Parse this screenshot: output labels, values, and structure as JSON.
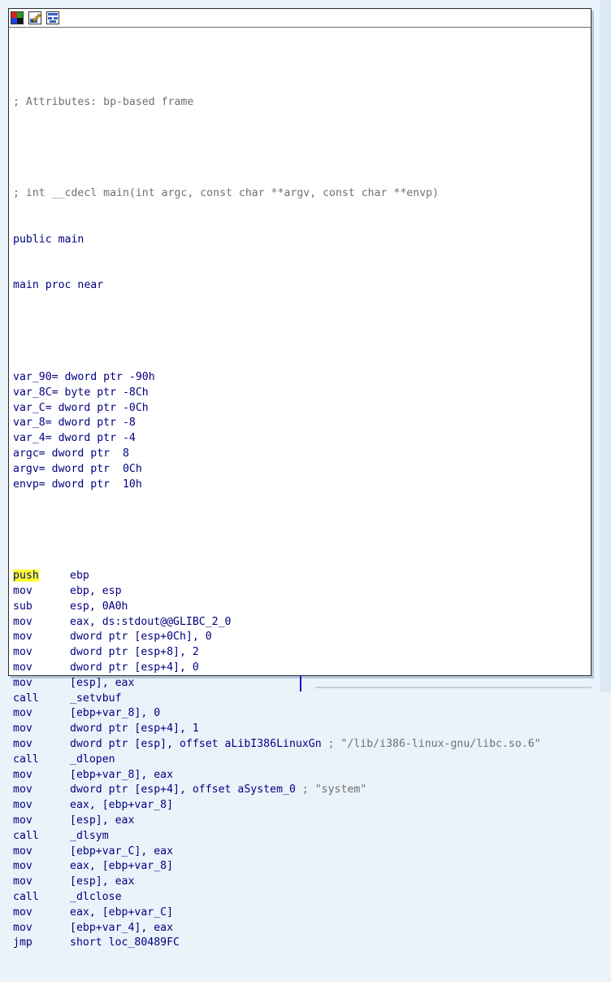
{
  "toolbar": {
    "icons": [
      "set-node-color-icon",
      "rename-icon",
      "graph-overview-icon"
    ]
  },
  "code": {
    "attributes_comment": "; Attributes: bp-based frame",
    "signature_comment": "; int __cdecl main(int argc, const char **argv, const char **envp)",
    "public_decl": "public main",
    "proc_decl": "main proc near",
    "vars": [
      "var_90= dword ptr -90h",
      "var_8C= byte ptr -8Ch",
      "var_C= dword ptr -0Ch",
      "var_8= dword ptr -8",
      "var_4= dword ptr -4",
      "argc= dword ptr  8",
      "argv= dword ptr  0Ch",
      "envp= dword ptr  10h"
    ],
    "instructions": [
      {
        "mnemonic": "push",
        "operands": "ebp",
        "comment": ""
      },
      {
        "mnemonic": "mov",
        "operands": "ebp, esp",
        "comment": ""
      },
      {
        "mnemonic": "sub",
        "operands": "esp, 0A0h",
        "comment": ""
      },
      {
        "mnemonic": "mov",
        "operands": "eax, ds:stdout@@GLIBC_2_0",
        "comment": ""
      },
      {
        "mnemonic": "mov",
        "operands": "dword ptr [esp+0Ch], 0",
        "comment": ""
      },
      {
        "mnemonic": "mov",
        "operands": "dword ptr [esp+8], 2",
        "comment": ""
      },
      {
        "mnemonic": "mov",
        "operands": "dword ptr [esp+4], 0",
        "comment": ""
      },
      {
        "mnemonic": "mov",
        "operands": "[esp], eax",
        "comment": ""
      },
      {
        "mnemonic": "call",
        "operands": "_setvbuf",
        "comment": ""
      },
      {
        "mnemonic": "mov",
        "operands": "[ebp+var_8], 0",
        "comment": ""
      },
      {
        "mnemonic": "mov",
        "operands": "dword ptr [esp+4], 1",
        "comment": ""
      },
      {
        "mnemonic": "mov",
        "operands": "dword ptr [esp], offset aLibI386LinuxGn",
        "comment": "; \"/lib/i386-linux-gnu/libc.so.6\""
      },
      {
        "mnemonic": "call",
        "operands": "_dlopen",
        "comment": ""
      },
      {
        "mnemonic": "mov",
        "operands": "[ebp+var_8], eax",
        "comment": ""
      },
      {
        "mnemonic": "mov",
        "operands": "dword ptr [esp+4], offset aSystem_0",
        "comment": "; \"system\""
      },
      {
        "mnemonic": "mov",
        "operands": "eax, [ebp+var_8]",
        "comment": ""
      },
      {
        "mnemonic": "mov",
        "operands": "[esp], eax",
        "comment": ""
      },
      {
        "mnemonic": "call",
        "operands": "_dlsym",
        "comment": ""
      },
      {
        "mnemonic": "mov",
        "operands": "[ebp+var_C], eax",
        "comment": ""
      },
      {
        "mnemonic": "mov",
        "operands": "eax, [ebp+var_8]",
        "comment": ""
      },
      {
        "mnemonic": "mov",
        "operands": "[esp], eax",
        "comment": ""
      },
      {
        "mnemonic": "call",
        "operands": "_dlclose",
        "comment": ""
      },
      {
        "mnemonic": "mov",
        "operands": "eax, [ebp+var_C]",
        "comment": ""
      },
      {
        "mnemonic": "mov",
        "operands": "[ebp+var_4], eax",
        "comment": ""
      },
      {
        "mnemonic": "jmp",
        "operands": "short loc_80489FC",
        "comment": ""
      }
    ]
  },
  "colors": {
    "code": "#000080",
    "comment": "#707070",
    "highlight": "#ffff33",
    "background": "#eaf3fa"
  }
}
